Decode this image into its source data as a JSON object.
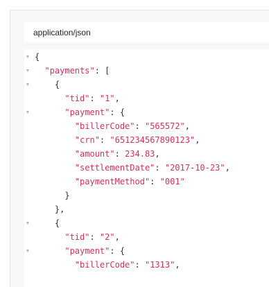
{
  "select": {
    "value": "application/json",
    "caret_icon": "chevron-down-icon"
  },
  "code_lines": [
    {
      "fold": true,
      "text": "{"
    },
    {
      "fold": true,
      "text": "  \"payments\": ["
    },
    {
      "fold": true,
      "text": "    {"
    },
    {
      "fold": false,
      "text": "      \"tid\": \"1\","
    },
    {
      "fold": true,
      "text": "      \"payment\": {"
    },
    {
      "fold": false,
      "text": "        \"billerCode\": \"565572\","
    },
    {
      "fold": false,
      "text": "        \"crn\": \"651234567890123\","
    },
    {
      "fold": false,
      "text": "        \"amount\": 234.83,"
    },
    {
      "fold": false,
      "text": "        \"settlementDate\": \"2017-10-23\","
    },
    {
      "fold": false,
      "text": "        \"paymentMethod\": \"001\""
    },
    {
      "fold": false,
      "text": "      }"
    },
    {
      "fold": false,
      "text": "    },"
    },
    {
      "fold": true,
      "text": "    {"
    },
    {
      "fold": false,
      "text": "      \"tid\": \"2\","
    },
    {
      "fold": true,
      "text": "      \"payment\": {"
    },
    {
      "fold": false,
      "text": "        \"billerCode\": \"1313\","
    }
  ],
  "colors": {
    "token": "#d4305a",
    "punctuation": "#333333",
    "fold_marker": "#b5b5b5"
  }
}
